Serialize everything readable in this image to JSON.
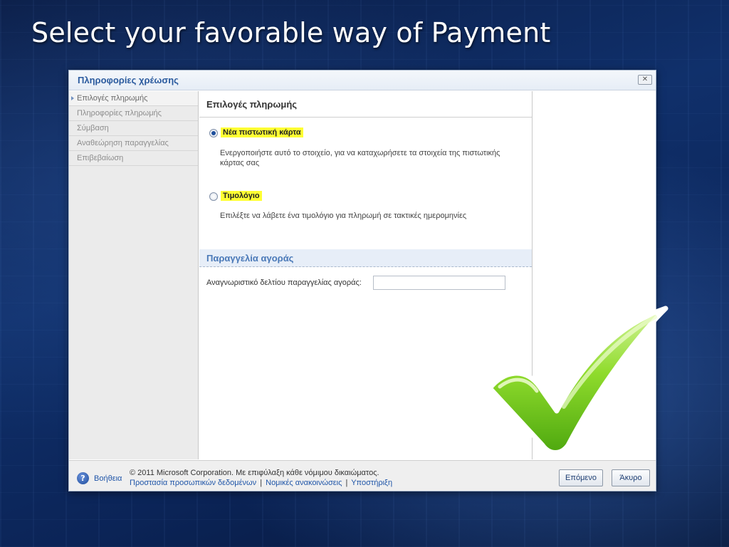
{
  "slide": {
    "title": "Select your favorable way of Payment"
  },
  "dialog": {
    "title": "Πληροφορίες χρέωσης",
    "close_label": "✕"
  },
  "nav": {
    "items": [
      {
        "label": "Επιλογές πληρωμής"
      },
      {
        "label": "Πληροφορίες πληρωμής"
      },
      {
        "label": "Σύμβαση"
      },
      {
        "label": "Αναθεώρηση παραγγελίας"
      },
      {
        "label": "Επιβεβαίωση"
      }
    ]
  },
  "payment": {
    "heading": "Επιλογές πληρωμής",
    "options": [
      {
        "label": "Νέα πιστωτική κάρτα",
        "description": "Ενεργοποιήστε αυτό το στοιχείο, για να καταχωρήσετε τα στοιχεία της πιστωτικής κάρτας σας",
        "selected": true
      },
      {
        "label": "Τιμολόγιο",
        "description": "Επιλέξτε να λάβετε ένα τιμολόγιο για πληρωμή σε τακτικές ημερομηνίες",
        "selected": false
      }
    ]
  },
  "purchase_order": {
    "heading": "Παραγγελία αγοράς",
    "field_label": "Αναγνωριστικό δελτίου παραγγελίας αγοράς:",
    "field_value": ""
  },
  "footer": {
    "help_icon_glyph": "?",
    "help_label": "Βοήθεια",
    "copyright": "© 2011 Microsoft Corporation. Με επιφύλαξη κάθε νόμιμου δικαιώματος.",
    "links": [
      "Προστασία προσωπικών δεδομένων",
      "Νομικές ανακοινώσεις",
      "Υποστήριξη"
    ],
    "link_separator": "|",
    "next_label": "Επόμενο",
    "cancel_label": "Άκυρο"
  },
  "colors": {
    "accent": "#2a5a9e",
    "highlight": "#ffff33",
    "checkmark": "#7ed321"
  },
  "icons": [
    "close-icon",
    "nav-arrow-icon",
    "help-icon",
    "checkmark-icon"
  ]
}
